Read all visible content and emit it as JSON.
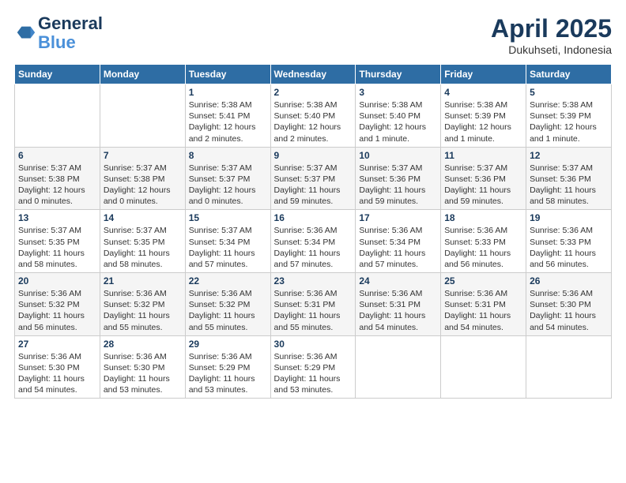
{
  "header": {
    "logo_line1": "General",
    "logo_line2": "Blue",
    "title": "April 2025",
    "subtitle": "Dukuhseti, Indonesia"
  },
  "weekdays": [
    "Sunday",
    "Monday",
    "Tuesday",
    "Wednesday",
    "Thursday",
    "Friday",
    "Saturday"
  ],
  "weeks": [
    [
      {
        "day": "",
        "info": ""
      },
      {
        "day": "",
        "info": ""
      },
      {
        "day": "1",
        "info": "Sunrise: 5:38 AM\nSunset: 5:41 PM\nDaylight: 12 hours and 2 minutes."
      },
      {
        "day": "2",
        "info": "Sunrise: 5:38 AM\nSunset: 5:40 PM\nDaylight: 12 hours and 2 minutes."
      },
      {
        "day": "3",
        "info": "Sunrise: 5:38 AM\nSunset: 5:40 PM\nDaylight: 12 hours and 1 minute."
      },
      {
        "day": "4",
        "info": "Sunrise: 5:38 AM\nSunset: 5:39 PM\nDaylight: 12 hours and 1 minute."
      },
      {
        "day": "5",
        "info": "Sunrise: 5:38 AM\nSunset: 5:39 PM\nDaylight: 12 hours and 1 minute."
      }
    ],
    [
      {
        "day": "6",
        "info": "Sunrise: 5:37 AM\nSunset: 5:38 PM\nDaylight: 12 hours and 0 minutes."
      },
      {
        "day": "7",
        "info": "Sunrise: 5:37 AM\nSunset: 5:38 PM\nDaylight: 12 hours and 0 minutes."
      },
      {
        "day": "8",
        "info": "Sunrise: 5:37 AM\nSunset: 5:37 PM\nDaylight: 12 hours and 0 minutes."
      },
      {
        "day": "9",
        "info": "Sunrise: 5:37 AM\nSunset: 5:37 PM\nDaylight: 11 hours and 59 minutes."
      },
      {
        "day": "10",
        "info": "Sunrise: 5:37 AM\nSunset: 5:36 PM\nDaylight: 11 hours and 59 minutes."
      },
      {
        "day": "11",
        "info": "Sunrise: 5:37 AM\nSunset: 5:36 PM\nDaylight: 11 hours and 59 minutes."
      },
      {
        "day": "12",
        "info": "Sunrise: 5:37 AM\nSunset: 5:36 PM\nDaylight: 11 hours and 58 minutes."
      }
    ],
    [
      {
        "day": "13",
        "info": "Sunrise: 5:37 AM\nSunset: 5:35 PM\nDaylight: 11 hours and 58 minutes."
      },
      {
        "day": "14",
        "info": "Sunrise: 5:37 AM\nSunset: 5:35 PM\nDaylight: 11 hours and 58 minutes."
      },
      {
        "day": "15",
        "info": "Sunrise: 5:37 AM\nSunset: 5:34 PM\nDaylight: 11 hours and 57 minutes."
      },
      {
        "day": "16",
        "info": "Sunrise: 5:36 AM\nSunset: 5:34 PM\nDaylight: 11 hours and 57 minutes."
      },
      {
        "day": "17",
        "info": "Sunrise: 5:36 AM\nSunset: 5:34 PM\nDaylight: 11 hours and 57 minutes."
      },
      {
        "day": "18",
        "info": "Sunrise: 5:36 AM\nSunset: 5:33 PM\nDaylight: 11 hours and 56 minutes."
      },
      {
        "day": "19",
        "info": "Sunrise: 5:36 AM\nSunset: 5:33 PM\nDaylight: 11 hours and 56 minutes."
      }
    ],
    [
      {
        "day": "20",
        "info": "Sunrise: 5:36 AM\nSunset: 5:32 PM\nDaylight: 11 hours and 56 minutes."
      },
      {
        "day": "21",
        "info": "Sunrise: 5:36 AM\nSunset: 5:32 PM\nDaylight: 11 hours and 55 minutes."
      },
      {
        "day": "22",
        "info": "Sunrise: 5:36 AM\nSunset: 5:32 PM\nDaylight: 11 hours and 55 minutes."
      },
      {
        "day": "23",
        "info": "Sunrise: 5:36 AM\nSunset: 5:31 PM\nDaylight: 11 hours and 55 minutes."
      },
      {
        "day": "24",
        "info": "Sunrise: 5:36 AM\nSunset: 5:31 PM\nDaylight: 11 hours and 54 minutes."
      },
      {
        "day": "25",
        "info": "Sunrise: 5:36 AM\nSunset: 5:31 PM\nDaylight: 11 hours and 54 minutes."
      },
      {
        "day": "26",
        "info": "Sunrise: 5:36 AM\nSunset: 5:30 PM\nDaylight: 11 hours and 54 minutes."
      }
    ],
    [
      {
        "day": "27",
        "info": "Sunrise: 5:36 AM\nSunset: 5:30 PM\nDaylight: 11 hours and 54 minutes."
      },
      {
        "day": "28",
        "info": "Sunrise: 5:36 AM\nSunset: 5:30 PM\nDaylight: 11 hours and 53 minutes."
      },
      {
        "day": "29",
        "info": "Sunrise: 5:36 AM\nSunset: 5:29 PM\nDaylight: 11 hours and 53 minutes."
      },
      {
        "day": "30",
        "info": "Sunrise: 5:36 AM\nSunset: 5:29 PM\nDaylight: 11 hours and 53 minutes."
      },
      {
        "day": "",
        "info": ""
      },
      {
        "day": "",
        "info": ""
      },
      {
        "day": "",
        "info": ""
      }
    ]
  ]
}
